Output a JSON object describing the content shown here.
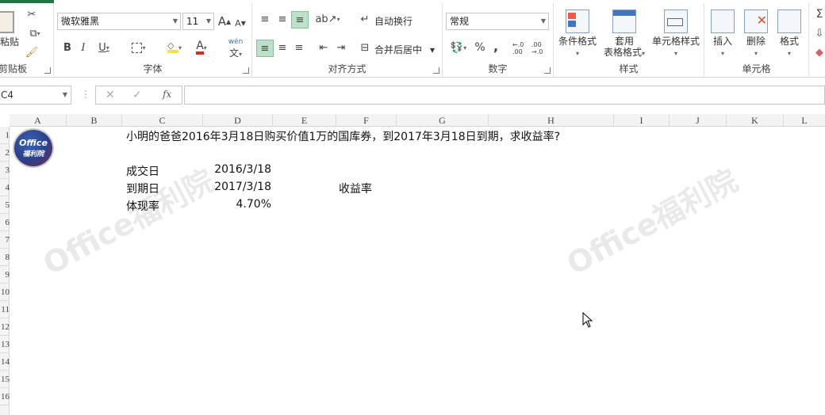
{
  "ribbon": {
    "clipboard": {
      "paste": "粘贴",
      "label": "剪贴板"
    },
    "font": {
      "name": "微软雅黑",
      "size": "11",
      "label": "字体",
      "grow": "A",
      "shrink": "A",
      "bold": "B",
      "italic": "I",
      "underline": "U",
      "font_color": "A",
      "phonetic": "wén"
    },
    "alignment": {
      "wrap": "自动换行",
      "merge": "合并后居中",
      "label": "对齐方式"
    },
    "number": {
      "format": "常规",
      "percent": "%",
      "comma": ",",
      "inc_decimal": "←.0 .00",
      "dec_decimal": ".00 →.0",
      "label": "数字"
    },
    "styles": {
      "conditional": "条件格式",
      "table_fmt_1": "套用",
      "table_fmt_2": "表格格式",
      "cell_styles": "单元格样式",
      "label": "样式"
    },
    "cells": {
      "insert": "插入",
      "delete": "删除",
      "format": "格式",
      "label": "单元格"
    }
  },
  "formula_bar": {
    "name_box": "C4",
    "fx": "fx",
    "value": ""
  },
  "columns": [
    "A",
    "B",
    "C",
    "D",
    "E",
    "F",
    "G",
    "H",
    "I",
    "J",
    "K",
    "L"
  ],
  "rows": [
    "1",
    "2",
    "3",
    "4",
    "5",
    "6",
    "7",
    "8",
    "9",
    "10",
    "11",
    "12",
    "13",
    "14",
    "15",
    "16"
  ],
  "cells": {
    "c1": "小明的爸爸2016年3月18日购买价值1万的国库券，到2017年3月18日到期，求收益率?",
    "c3": "成交日",
    "d3": "2016/3/18",
    "c4": "到期日",
    "d4": "2017/3/18",
    "f4": "收益率",
    "c5": "体现率",
    "d5": "4.70%"
  },
  "logo": {
    "line1": "Office",
    "line2": "福利院"
  },
  "watermark": "Office福利院",
  "colors": {
    "accent": "#217346",
    "selected": "#bde0c8"
  }
}
